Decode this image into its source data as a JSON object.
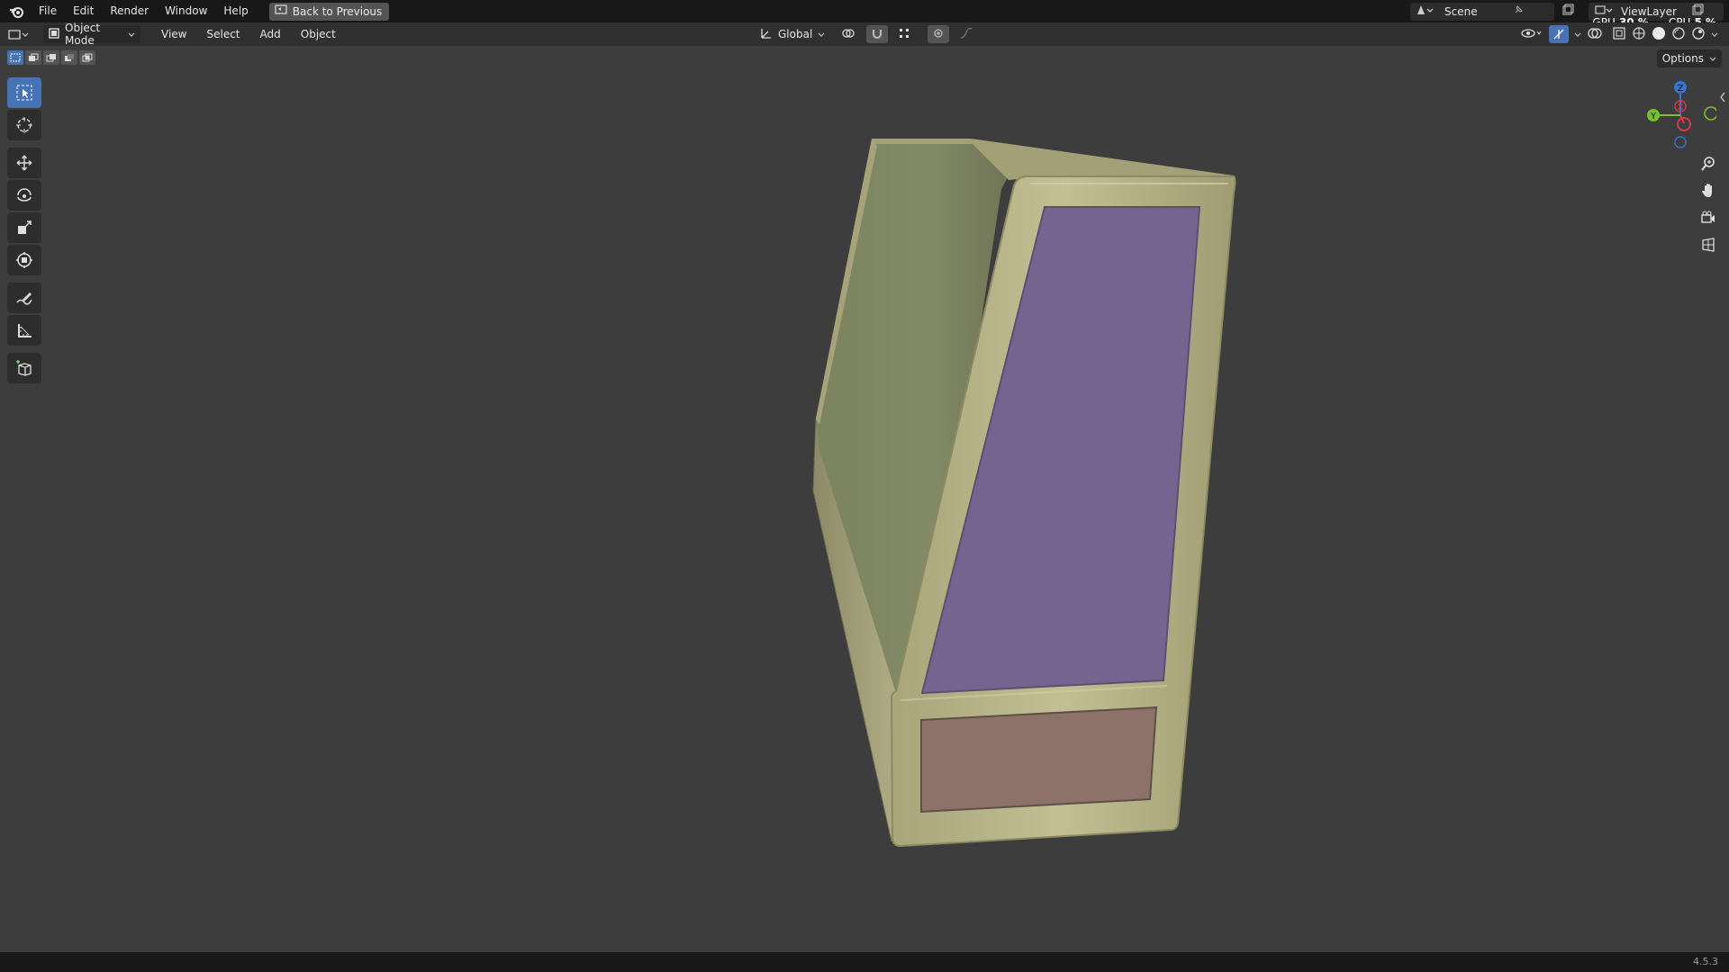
{
  "topbar": {
    "menu": [
      "File",
      "Edit",
      "Render",
      "Window",
      "Help"
    ],
    "back_label": "Back to Previous",
    "scene_label": "Scene",
    "viewlayer_label": "ViewLayer",
    "gpu_label": "GPU",
    "gpu_value": "30 %",
    "cpu_label": "CPU",
    "cpu_value": "5 %"
  },
  "header": {
    "mode_label": "Object Mode",
    "menu": [
      "View",
      "Select",
      "Add",
      "Object"
    ],
    "orientation_label": "Global"
  },
  "options_label": "Options",
  "gizmo": {
    "z": "Z",
    "x": "X",
    "y": "Y"
  },
  "status": {
    "version": "4.5.3"
  },
  "colors": {
    "accent": "#4772b3",
    "frame": "#b2af85",
    "side_panel": "#838a66",
    "front_panel": "#76638f",
    "lower_panel": "#8c7268"
  },
  "icons": [
    "blender-logo-icon",
    "back-icon",
    "scene-icon",
    "pin-icon",
    "viewlayer-icon",
    "select-box-icon",
    "cursor-icon",
    "move-icon",
    "rotate-icon",
    "scale-icon",
    "transform-icon",
    "annotate-icon",
    "measure-icon",
    "add-cube-icon",
    "zoom-icon",
    "hand-icon",
    "camera-icon",
    "grid-icon"
  ]
}
